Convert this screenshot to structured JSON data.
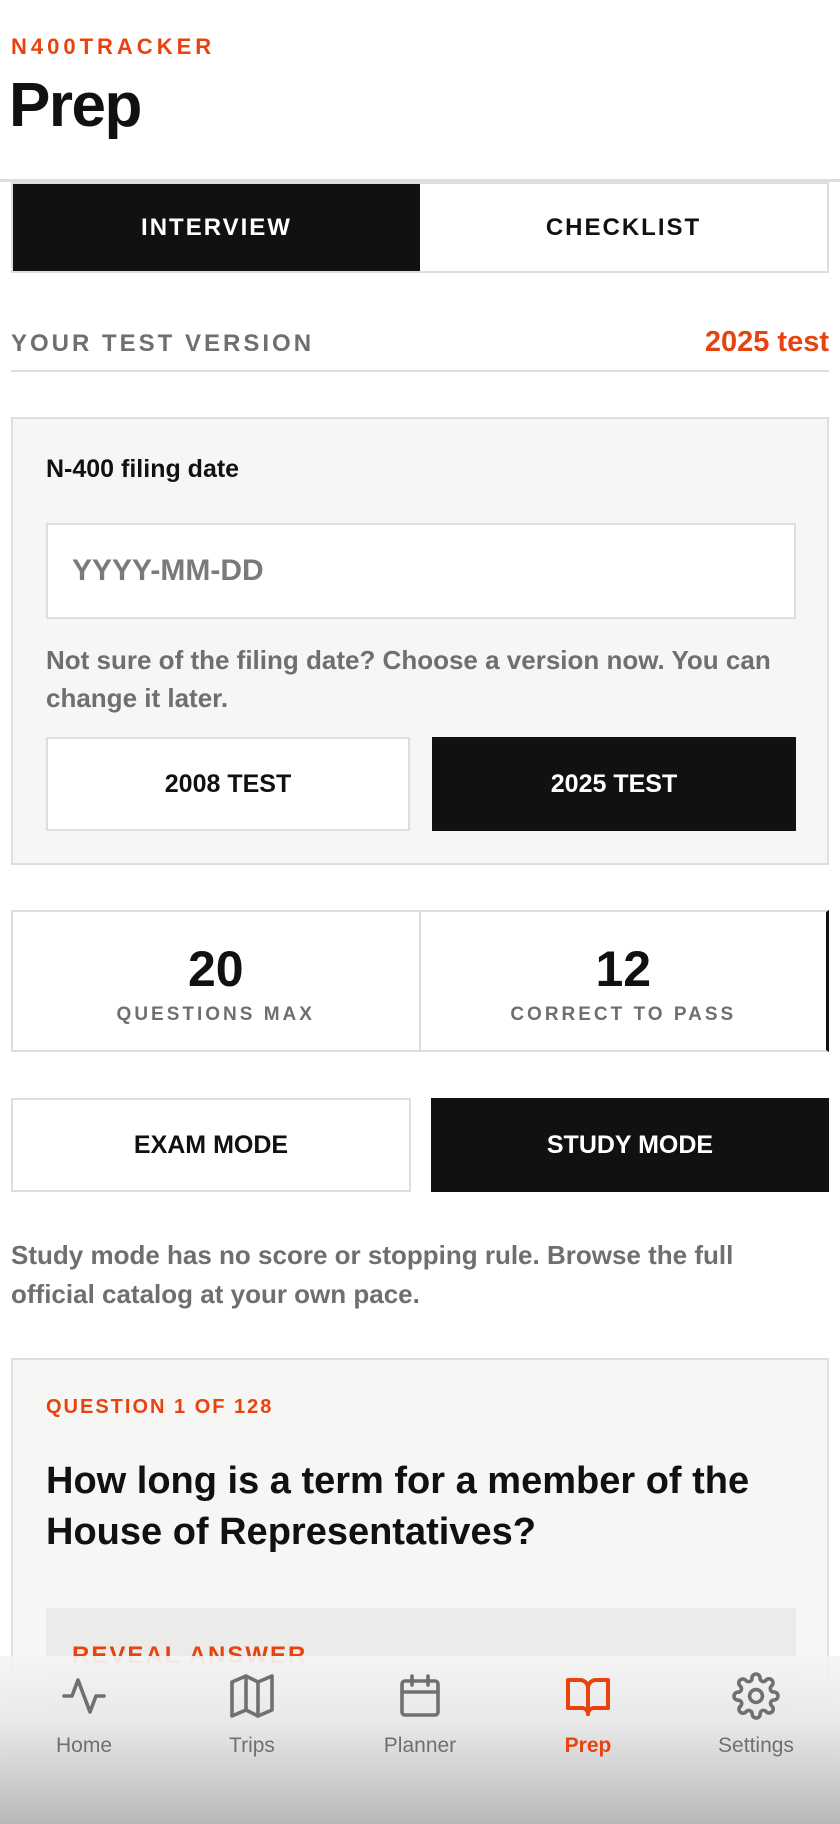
{
  "header": {
    "brand": "N400TRACKER",
    "title": "Prep"
  },
  "tabs": [
    {
      "label": "INTERVIEW",
      "active": true
    },
    {
      "label": "CHECKLIST",
      "active": false
    }
  ],
  "test_version": {
    "label": "YOUR TEST VERSION",
    "value": "2025 test"
  },
  "filing": {
    "label": "N-400 filing date",
    "input_value": "",
    "placeholder": "YYYY-MM-DD",
    "note": "Not sure of the filing date? Choose a version now. You can change it later.",
    "versions": [
      {
        "label": "2008 TEST",
        "selected": false
      },
      {
        "label": "2025 TEST",
        "selected": true
      }
    ]
  },
  "stats": [
    {
      "value": "20",
      "label": "QUESTIONS MAX"
    },
    {
      "value": "12",
      "label": "CORRECT TO PASS"
    }
  ],
  "modes": [
    {
      "label": "EXAM MODE",
      "selected": false
    },
    {
      "label": "STUDY MODE",
      "selected": true
    }
  ],
  "mode_note": "Study mode has no score or stopping rule. Browse the full official catalog at your own pace.",
  "question": {
    "counter": "QUESTION 1 OF 128",
    "text": "How long is a term for a member of the House of Representatives?",
    "reveal_label": "REVEAL ANSWER"
  },
  "nav": [
    {
      "label": "Home",
      "icon": "activity-icon",
      "active": false
    },
    {
      "label": "Trips",
      "icon": "map-icon",
      "active": false
    },
    {
      "label": "Planner",
      "icon": "calendar-icon",
      "active": false
    },
    {
      "label": "Prep",
      "icon": "book-open-icon",
      "active": true
    },
    {
      "label": "Settings",
      "icon": "gear-icon",
      "active": false
    }
  ],
  "colors": {
    "accent": "#e8430f",
    "dark": "#111111",
    "muted": "#6f6f6f",
    "border": "#dedede",
    "card_bg": "#f6f6f5",
    "nav_inactive": "#707070"
  }
}
